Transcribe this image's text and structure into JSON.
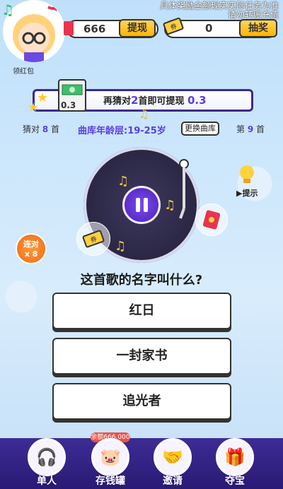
{
  "header": {
    "avatar_label": "领红包",
    "cash_value": "666",
    "withdraw_label": "提现",
    "ticket_value": "0",
    "lottery_label": "抽奖",
    "notice_line1": "具体奖励金额现实实际任务为准",
    "notice_line2": "请勿转账充值"
  },
  "progress": {
    "prefix": "再猜对",
    "count": "2",
    "suffix": "首即可提现",
    "amount": "0.3",
    "money_value": "0.3"
  },
  "stats": {
    "guessed_prefix": "猜对",
    "guessed_count": "8",
    "guessed_suffix": "首",
    "age_range": "曲库年龄层:19-25岁",
    "swap_label": "更换曲库",
    "current_prefix": "第",
    "current_count": "9",
    "current_suffix": "首"
  },
  "game": {
    "hint_label": "提示",
    "combo_label": "连对",
    "combo_value": "x 8",
    "question": "这首歌的名字叫什么?",
    "answers": [
      "红日",
      "一封家书",
      "追光者"
    ]
  },
  "nav": {
    "balance_tag": "余额666.000",
    "items": [
      "单人",
      "存钱罐",
      "邀请",
      "夺宝"
    ]
  }
}
